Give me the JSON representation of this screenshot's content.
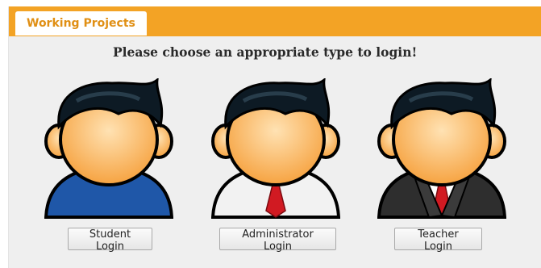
{
  "tab": {
    "label": "Working Projects"
  },
  "heading": "Please choose an appropriate type to login!",
  "logins": [
    {
      "label": "Student Login",
      "avatar": "student-avatar-icon",
      "shirt": "#1f57a8"
    },
    {
      "label": "Administrator Login",
      "avatar": "administrator-avatar-icon",
      "shirt": "#f2f2f2",
      "tie": "#d11a22"
    },
    {
      "label": "Teacher Login",
      "avatar": "teacher-avatar-icon",
      "shirt": "#2e2e2e",
      "tie": "#d11a22"
    }
  ],
  "colors": {
    "accent": "#f3a325",
    "skin": "#f9b25e",
    "hair": "#0d1a24"
  }
}
